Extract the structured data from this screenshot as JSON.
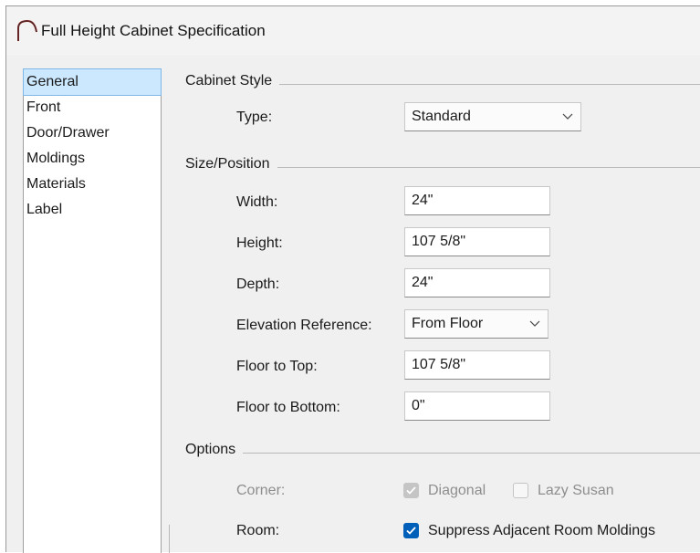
{
  "window": {
    "title": "Full Height Cabinet Specification"
  },
  "nav": {
    "items": [
      {
        "label": "General",
        "selected": true
      },
      {
        "label": "Front"
      },
      {
        "label": "Door/Drawer"
      },
      {
        "label": "Moldings"
      },
      {
        "label": "Materials"
      },
      {
        "label": "Label"
      }
    ]
  },
  "cabinet_style": {
    "heading": "Cabinet Style",
    "type_label": "Type:",
    "type_value": "Standard"
  },
  "size_position": {
    "heading": "Size/Position",
    "width_label": "Width:",
    "width_value": "24\"",
    "height_label": "Height:",
    "height_value": "107 5/8\"",
    "depth_label": "Depth:",
    "depth_value": "24\"",
    "elevation_label": "Elevation Reference:",
    "elevation_value": "From Floor",
    "floor_top_label": "Floor to Top:",
    "floor_top_value": "107 5/8\"",
    "floor_bottom_label": "Floor to Bottom:",
    "floor_bottom_value": "0\""
  },
  "options": {
    "heading": "Options",
    "corner_label": "Corner:",
    "diagonal_label": "Diagonal",
    "diagonal_checked": true,
    "lazy_susan_label": "Lazy Susan",
    "lazy_susan_checked": false,
    "room_label": "Room:",
    "suppress_label": "Suppress Adjacent Room Moldings",
    "suppress_checked": true
  },
  "colors": {
    "accent": "#005fb8",
    "selection": "#cce8ff",
    "disabled_text": "#8e8e8e"
  }
}
